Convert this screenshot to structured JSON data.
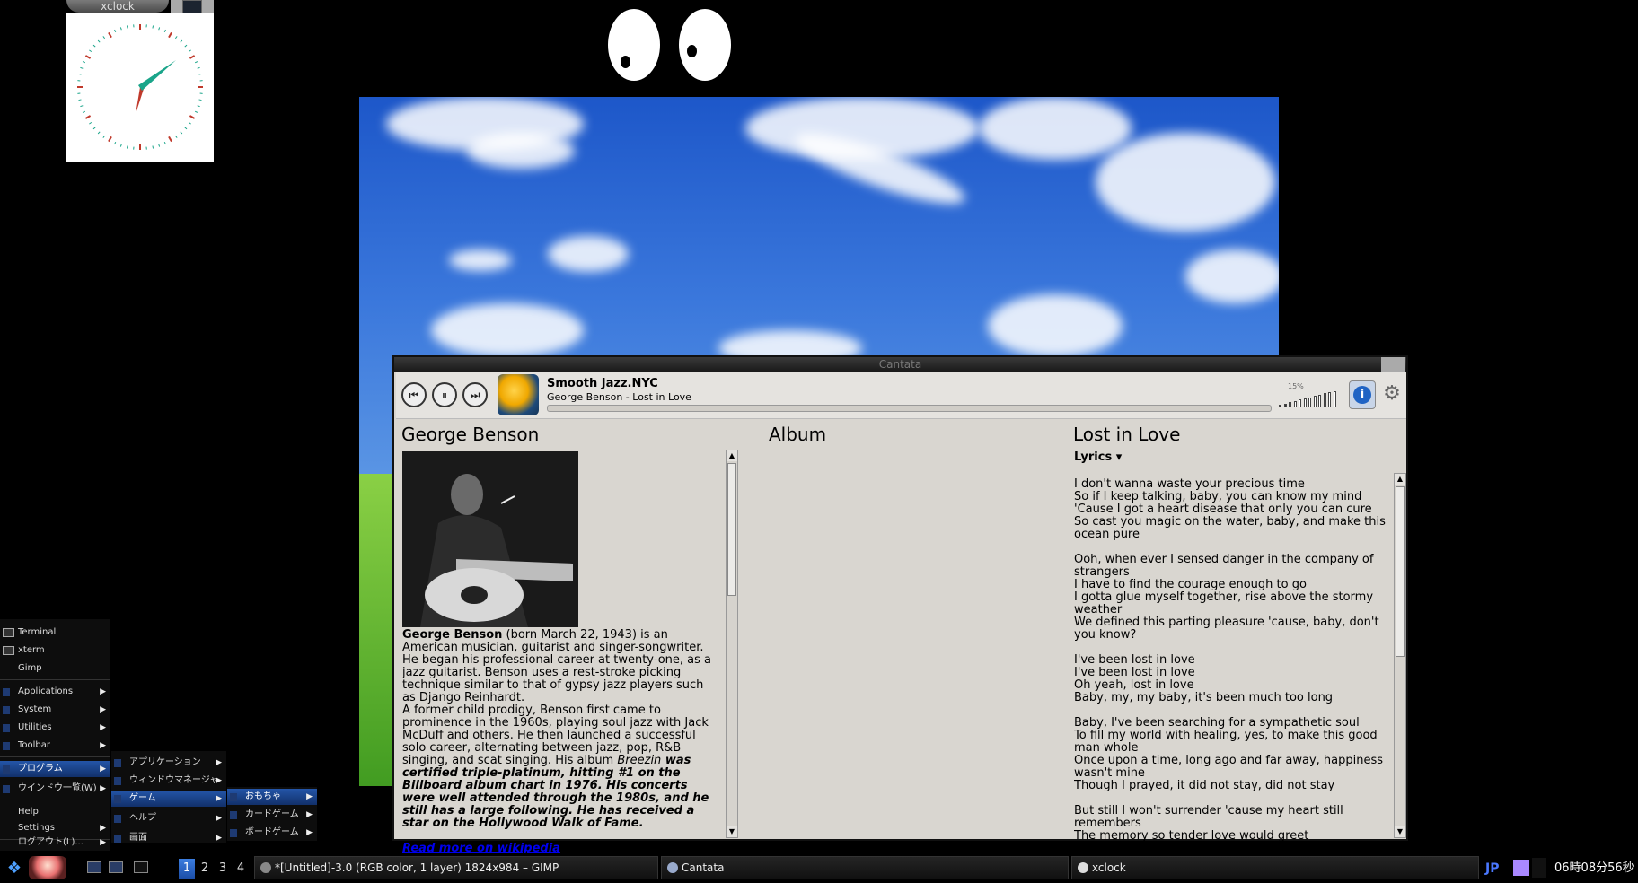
{
  "xclock": {
    "title": "xclock"
  },
  "cantata": {
    "title": "Cantata",
    "now_playing": {
      "station": "Smooth Jazz.NYC",
      "track": "George Benson - Lost in Love"
    },
    "volume_label": "15%",
    "volume_level": 0.15,
    "columns": {
      "artist": "George Benson",
      "album": "Album",
      "song": "Lost in Love"
    },
    "bio": {
      "name": "George Benson",
      "text1": " (born March 22, 1943) is an American musician, guitarist and singer-songwriter. He began his professional career at twenty-one, as a jazz guitarist. Benson uses a rest-stroke picking technique similar to that of gypsy jazz players such as Django Reinhardt.",
      "text2": "A former child prodigy, Benson first came to prominence in the 1960s, playing soul jazz with Jack McDuff and others. He then launched a successful solo career, alternating between jazz, pop, R&B singing, and scat singing. His album ",
      "album_italic": "Breezin",
      "text3": " was certified triple-platinum, hitting #1 on the Billboard album chart in 1976. His concerts were well attended through the 1980s, and he still has a large following. He has received a star on the Hollywood Walk of Fame.",
      "link": "Read more on wikipedia"
    },
    "lyrics_selector": "Lyrics ▾",
    "lyrics": "I don't wanna waste your precious time\nSo if I keep talking, baby, you can know my mind\n'Cause I got a heart disease that only you can cure\nSo cast you magic on the water, baby, and make this ocean pure\n\nOoh, when ever I sensed danger in the company of strangers\nI have to find the courage enough to go\nI gotta glue myself together, rise above the stormy weather\nWe defined this parting pleasure 'cause, baby, don't you know?\n\nI've been lost in love\nI've been lost in love\nOh yeah, lost in love\nBaby, my, my baby, it's been much too long\n\nBaby, I've been searching for a sympathetic soul\nTo fill my world with healing, yes, to make this good man whole\nOnce upon a time, long ago and far away, happiness wasn't mine\nThough I prayed, it did not stay, did not stay\n\nBut still I won't surrender 'cause my heart still remembers\nThe memory so tender love would greet"
  },
  "root_menu": {
    "items": [
      "Terminal",
      "xterm",
      "Gimp",
      "Applications",
      "System",
      "Utilities",
      "Toolbar",
      "プログラム",
      "ウインドウ一覧(W)",
      "Help",
      "Settings",
      "ログアウト(L)..."
    ],
    "sub1": [
      "アプリケーション",
      "ウィンドウマネージャ",
      "ゲーム",
      "ヘルプ",
      "画面"
    ],
    "sub2": [
      "おもちゃ",
      "カードゲーム",
      "ボードゲーム"
    ]
  },
  "taskbar": {
    "workspaces": [
      "1",
      "2",
      "3",
      "4"
    ],
    "tasks": [
      "*[Untitled]-3.0 (RGB color, 1 layer) 1824x984 – GIMP",
      "Cantata",
      "xclock"
    ],
    "ime": "JP",
    "clock": "06時08分56秒"
  },
  "colors": {
    "accent": "#2455a8",
    "link": "#0000ee"
  }
}
